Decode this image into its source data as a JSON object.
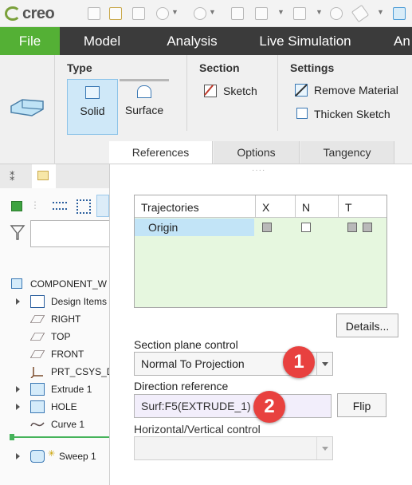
{
  "app": {
    "logo_text": "creo"
  },
  "menu": {
    "file": "File",
    "model": "Model",
    "analysis": "Analysis",
    "live_simulation": "Live Simulation",
    "overflow": "An"
  },
  "ribbon": {
    "type_group": "Type",
    "solid": "Solid",
    "surface": "Surface",
    "section_group": "Section",
    "sketch": "Sketch",
    "settings_group": "Settings",
    "remove_material": "Remove Material",
    "thicken_sketch": "Thicken Sketch",
    "tabs": {
      "references": "References",
      "options": "Options",
      "tangency": "Tangency"
    }
  },
  "tree": {
    "root": "COMPONENT_W",
    "items": [
      "Design Items",
      "RIGHT",
      "TOP",
      "FRONT",
      "PRT_CSYS_DE",
      "Extrude 1",
      "HOLE",
      "Curve 1",
      "Sweep 1"
    ]
  },
  "panel": {
    "table": {
      "headers": [
        "Trajectories",
        "X",
        "N",
        "T"
      ],
      "rows": [
        {
          "name": "Origin"
        }
      ]
    },
    "details_button": "Details...",
    "section_plane_label": "Section plane control",
    "section_plane_value": "Normal To Projection",
    "direction_label": "Direction reference",
    "direction_value": "Surf:F5(EXTRUDE_1)",
    "flip_button": "Flip",
    "hv_label": "Horizontal/Vertical control",
    "hv_value": ""
  },
  "callouts": [
    "1",
    "2"
  ],
  "colors": {
    "file_green": "#54b035",
    "menu_dark": "#3b3b3b",
    "selected_row": "#c2e4f7",
    "table_bg": "#e6f7df",
    "badge_red": "#e8413f",
    "direction_field": "#f2eefb"
  }
}
